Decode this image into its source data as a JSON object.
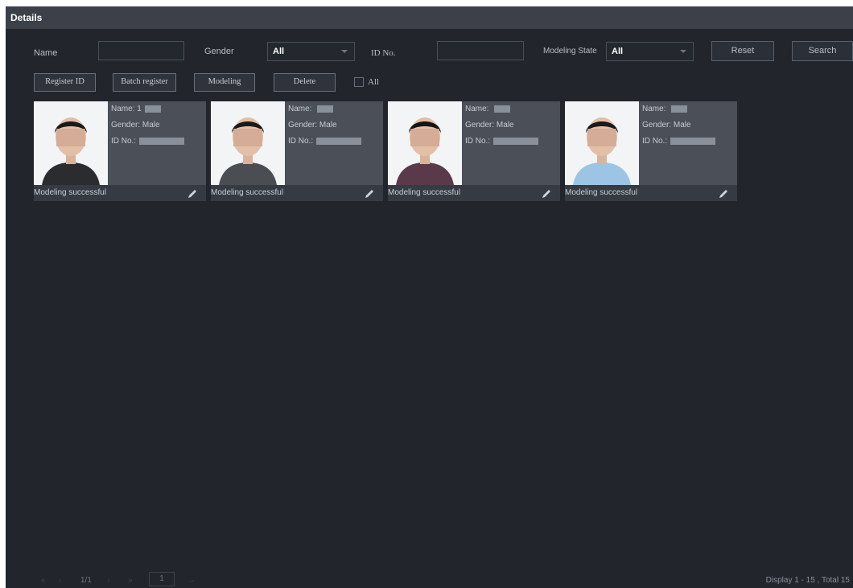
{
  "window": {
    "title": "Details"
  },
  "filters": {
    "name_label": "Name",
    "name_value": "",
    "gender_label": "Gender",
    "gender_value": "All",
    "id_label": "ID No.",
    "id_value": "",
    "state_label": "Modeling State",
    "state_value": "All",
    "reset_label": "Reset",
    "search_label": "Search"
  },
  "toolbar": {
    "register_label": "Register ID",
    "batch_label": "Batch register",
    "modeling_label": "Modeling",
    "delete_label": "Delete",
    "all_label": "All"
  },
  "cards": [
    {
      "name_label": "Name:",
      "name_prefix": "1",
      "gender": "Gender: Male",
      "id_label": "ID No.:",
      "status": "Modeling successful",
      "shirt_color": "#2a2c30",
      "hair_color": "#1a1a1a"
    },
    {
      "name_label": "Name:",
      "name_prefix": "",
      "gender": "Gender: Male",
      "id_label": "ID No.:",
      "status": "Modeling successful",
      "shirt_color": "#4a4e52",
      "hair_color": "#1a1a1a"
    },
    {
      "name_label": "Name:",
      "name_prefix": "",
      "gender": "Gender: Male",
      "id_label": "ID No.:",
      "status": "Modeling successful",
      "shirt_color": "#5a3a4a",
      "hair_color": "#151515"
    },
    {
      "name_label": "Name:",
      "name_prefix": "",
      "gender": "Gender: Male",
      "id_label": "ID No.:",
      "status": "Modeling successful",
      "shirt_color": "#9cc4e4",
      "hair_color": "#1a1a1a"
    }
  ],
  "pagination": {
    "page_text": "1/1",
    "page_input": "1"
  },
  "footer": {
    "display_text": "Display 1 - 15 , Total 15"
  },
  "colors": {
    "background": "#22262c",
    "titlebar": "#3b4049",
    "card_info": "#4a4f58"
  }
}
